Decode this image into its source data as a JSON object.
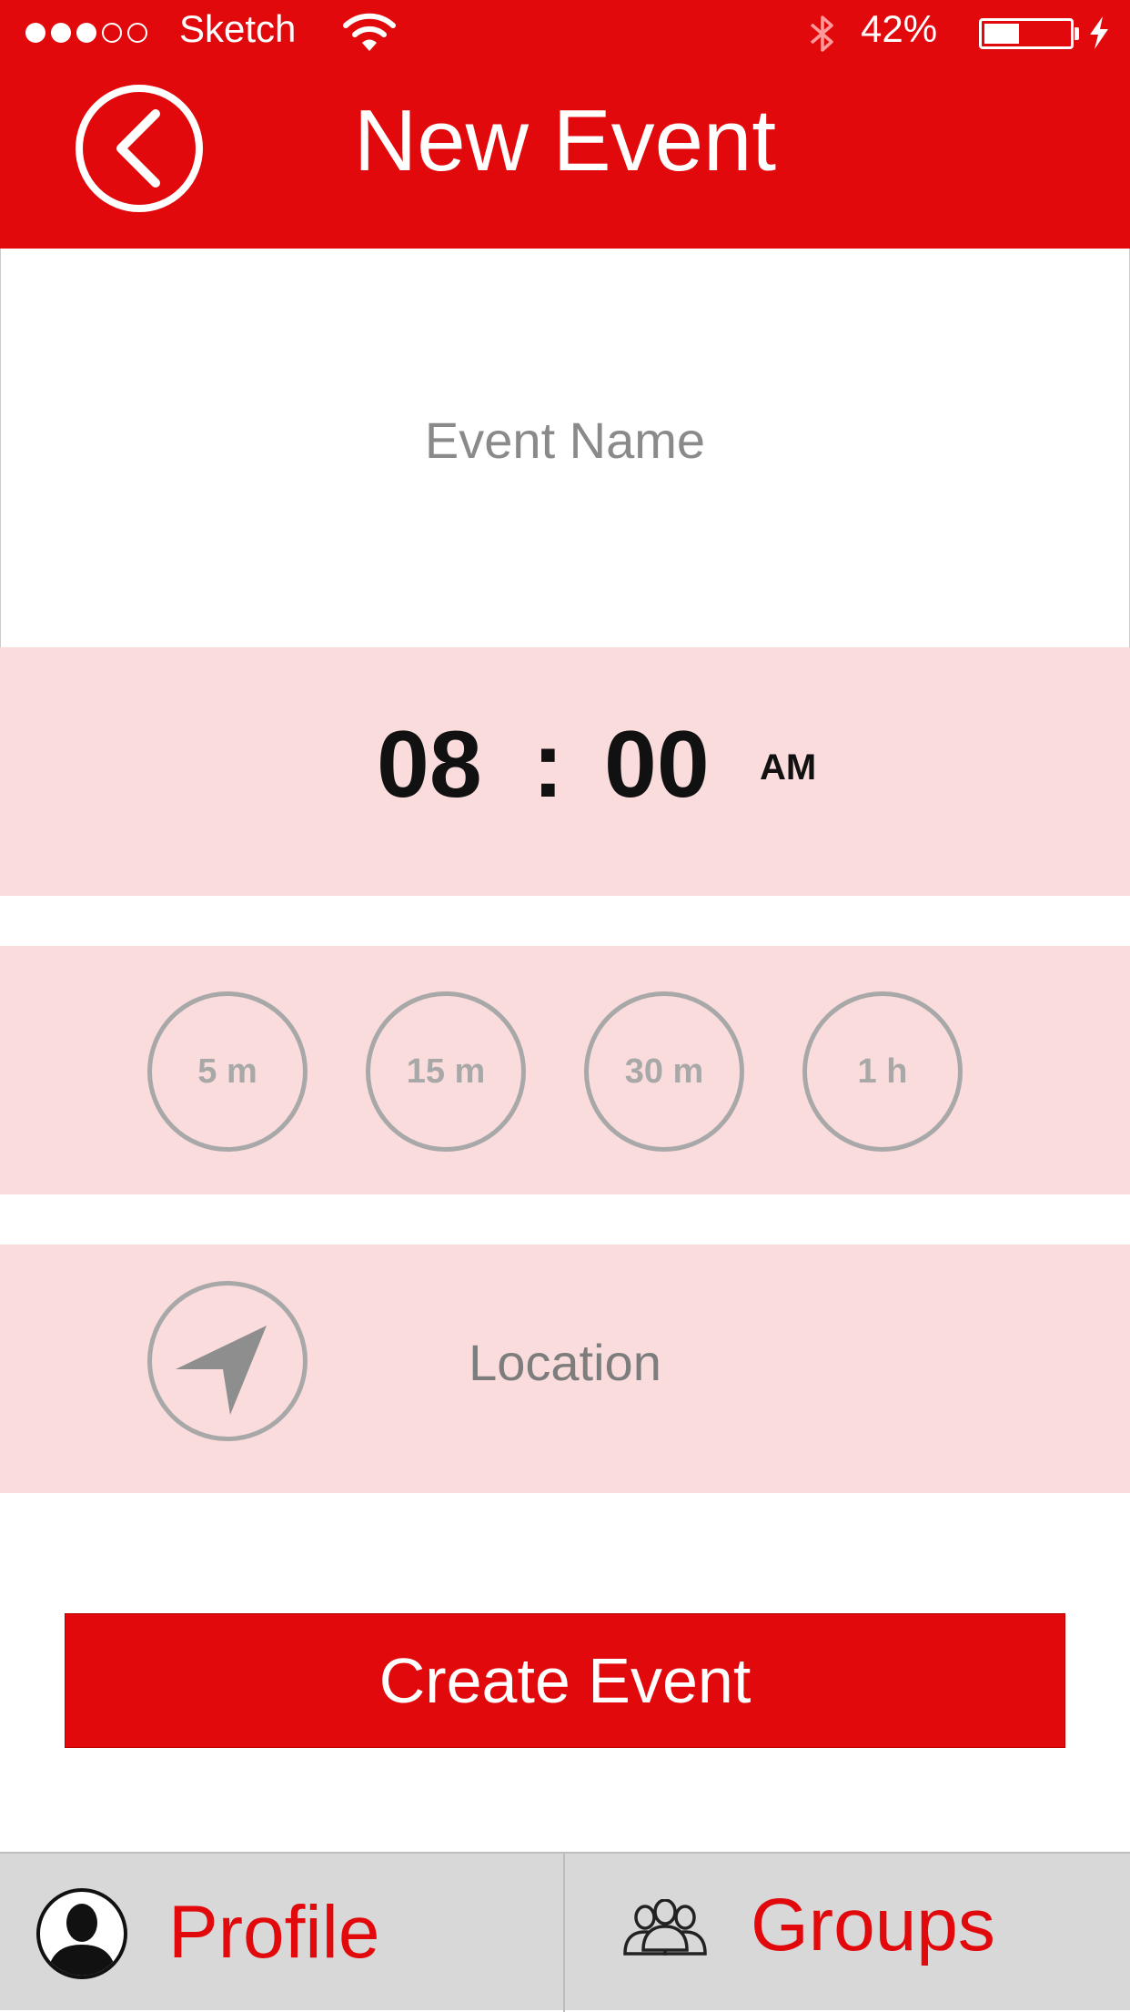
{
  "status_bar": {
    "carrier": "Sketch",
    "battery_percent": "42%",
    "signal_bars_filled": 3,
    "signal_bars_total": 5,
    "battery_level": 0.42
  },
  "header": {
    "title": "New Event",
    "back_icon": "chevron-left-circle-icon"
  },
  "form": {
    "event_name_placeholder": "Event Name",
    "time": {
      "hour": "08",
      "separator": ":",
      "minute": "00",
      "period": "AM"
    },
    "durations": [
      {
        "label": "5 m"
      },
      {
        "label": "15 m"
      },
      {
        "label": "30 m"
      },
      {
        "label": "1 h"
      }
    ],
    "location": {
      "label": "Location",
      "icon": "location-arrow-icon"
    },
    "create_button": "Create Event"
  },
  "tabbar": {
    "profile": {
      "label": "Profile",
      "icon": "profile-icon"
    },
    "groups": {
      "label": "Groups",
      "icon": "groups-icon"
    }
  },
  "colors": {
    "brand_red": "#E1090C",
    "row_pink": "#FADCDD",
    "tab_gray": "#D8D8D8"
  }
}
